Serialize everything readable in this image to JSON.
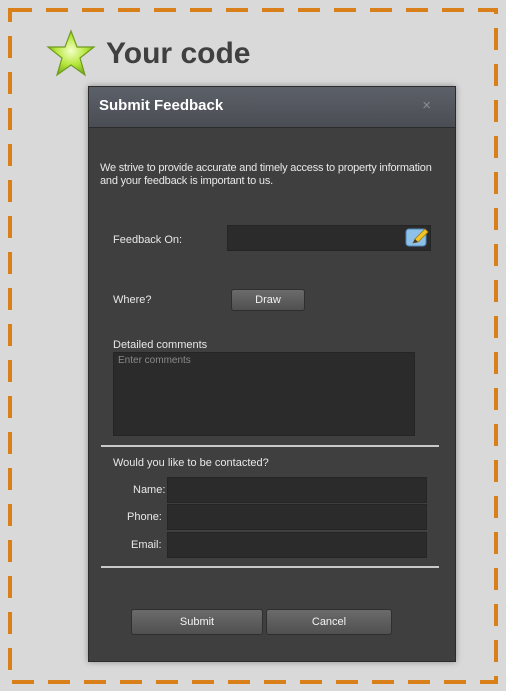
{
  "page": {
    "header_title": "Your code",
    "header_icon": "star-icon"
  },
  "dialog": {
    "title": "Submit Feedback",
    "close_symbol": "×",
    "intro_text": "We strive to provide accurate and timely access to property information and your feedback is important to us.",
    "feedback_on_label": "Feedback On:",
    "feedback_on_value": "",
    "where_label": "Where?",
    "draw_button": "Draw",
    "comments_label": "Detailed comments",
    "comments_placeholder": "Enter comments",
    "contact_question": "Would you like to be contacted?",
    "name_label": "Name:",
    "phone_label": "Phone:",
    "email_label": "Email:",
    "submit_button": "Submit",
    "cancel_button": "Cancel"
  },
  "colors": {
    "frame_dash": "#d9801a",
    "frame_bg": "#d9d9d9",
    "dialog_bg": "#3f3f3f",
    "titlebar": "#4f535a"
  }
}
